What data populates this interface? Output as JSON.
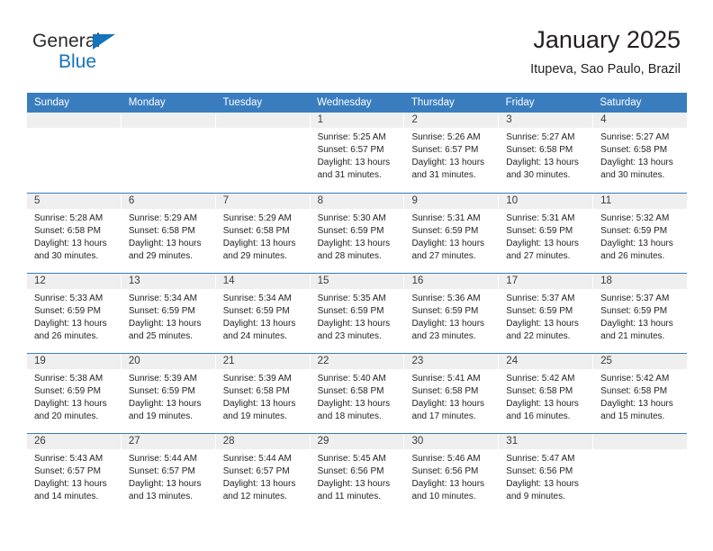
{
  "brand": {
    "name_top": "General",
    "name_bottom": "Blue",
    "triangle_color": "#1574bb"
  },
  "header": {
    "title": "January 2025",
    "subtitle": "Itupeva, Sao Paulo, Brazil"
  },
  "theme": {
    "header_blue": "#3a7dbf",
    "day_band_gray": "#efefef",
    "text_color": "#231f20"
  },
  "weekdays": [
    "Sunday",
    "Monday",
    "Tuesday",
    "Wednesday",
    "Thursday",
    "Friday",
    "Saturday"
  ],
  "weeks": [
    [
      {
        "day": "",
        "sunrise": "",
        "sunset": "",
        "daylight1": "",
        "daylight2": "",
        "empty": true
      },
      {
        "day": "",
        "sunrise": "",
        "sunset": "",
        "daylight1": "",
        "daylight2": "",
        "empty": true
      },
      {
        "day": "",
        "sunrise": "",
        "sunset": "",
        "daylight1": "",
        "daylight2": "",
        "empty": true
      },
      {
        "day": "1",
        "sunrise": "Sunrise: 5:25 AM",
        "sunset": "Sunset: 6:57 PM",
        "daylight1": "Daylight: 13 hours",
        "daylight2": "and 31 minutes."
      },
      {
        "day": "2",
        "sunrise": "Sunrise: 5:26 AM",
        "sunset": "Sunset: 6:57 PM",
        "daylight1": "Daylight: 13 hours",
        "daylight2": "and 31 minutes."
      },
      {
        "day": "3",
        "sunrise": "Sunrise: 5:27 AM",
        "sunset": "Sunset: 6:58 PM",
        "daylight1": "Daylight: 13 hours",
        "daylight2": "and 30 minutes."
      },
      {
        "day": "4",
        "sunrise": "Sunrise: 5:27 AM",
        "sunset": "Sunset: 6:58 PM",
        "daylight1": "Daylight: 13 hours",
        "daylight2": "and 30 minutes."
      }
    ],
    [
      {
        "day": "5",
        "sunrise": "Sunrise: 5:28 AM",
        "sunset": "Sunset: 6:58 PM",
        "daylight1": "Daylight: 13 hours",
        "daylight2": "and 30 minutes."
      },
      {
        "day": "6",
        "sunrise": "Sunrise: 5:29 AM",
        "sunset": "Sunset: 6:58 PM",
        "daylight1": "Daylight: 13 hours",
        "daylight2": "and 29 minutes."
      },
      {
        "day": "7",
        "sunrise": "Sunrise: 5:29 AM",
        "sunset": "Sunset: 6:58 PM",
        "daylight1": "Daylight: 13 hours",
        "daylight2": "and 29 minutes."
      },
      {
        "day": "8",
        "sunrise": "Sunrise: 5:30 AM",
        "sunset": "Sunset: 6:59 PM",
        "daylight1": "Daylight: 13 hours",
        "daylight2": "and 28 minutes."
      },
      {
        "day": "9",
        "sunrise": "Sunrise: 5:31 AM",
        "sunset": "Sunset: 6:59 PM",
        "daylight1": "Daylight: 13 hours",
        "daylight2": "and 27 minutes."
      },
      {
        "day": "10",
        "sunrise": "Sunrise: 5:31 AM",
        "sunset": "Sunset: 6:59 PM",
        "daylight1": "Daylight: 13 hours",
        "daylight2": "and 27 minutes."
      },
      {
        "day": "11",
        "sunrise": "Sunrise: 5:32 AM",
        "sunset": "Sunset: 6:59 PM",
        "daylight1": "Daylight: 13 hours",
        "daylight2": "and 26 minutes."
      }
    ],
    [
      {
        "day": "12",
        "sunrise": "Sunrise: 5:33 AM",
        "sunset": "Sunset: 6:59 PM",
        "daylight1": "Daylight: 13 hours",
        "daylight2": "and 26 minutes."
      },
      {
        "day": "13",
        "sunrise": "Sunrise: 5:34 AM",
        "sunset": "Sunset: 6:59 PM",
        "daylight1": "Daylight: 13 hours",
        "daylight2": "and 25 minutes."
      },
      {
        "day": "14",
        "sunrise": "Sunrise: 5:34 AM",
        "sunset": "Sunset: 6:59 PM",
        "daylight1": "Daylight: 13 hours",
        "daylight2": "and 24 minutes."
      },
      {
        "day": "15",
        "sunrise": "Sunrise: 5:35 AM",
        "sunset": "Sunset: 6:59 PM",
        "daylight1": "Daylight: 13 hours",
        "daylight2": "and 23 minutes."
      },
      {
        "day": "16",
        "sunrise": "Sunrise: 5:36 AM",
        "sunset": "Sunset: 6:59 PM",
        "daylight1": "Daylight: 13 hours",
        "daylight2": "and 23 minutes."
      },
      {
        "day": "17",
        "sunrise": "Sunrise: 5:37 AM",
        "sunset": "Sunset: 6:59 PM",
        "daylight1": "Daylight: 13 hours",
        "daylight2": "and 22 minutes."
      },
      {
        "day": "18",
        "sunrise": "Sunrise: 5:37 AM",
        "sunset": "Sunset: 6:59 PM",
        "daylight1": "Daylight: 13 hours",
        "daylight2": "and 21 minutes."
      }
    ],
    [
      {
        "day": "19",
        "sunrise": "Sunrise: 5:38 AM",
        "sunset": "Sunset: 6:59 PM",
        "daylight1": "Daylight: 13 hours",
        "daylight2": "and 20 minutes."
      },
      {
        "day": "20",
        "sunrise": "Sunrise: 5:39 AM",
        "sunset": "Sunset: 6:59 PM",
        "daylight1": "Daylight: 13 hours",
        "daylight2": "and 19 minutes."
      },
      {
        "day": "21",
        "sunrise": "Sunrise: 5:39 AM",
        "sunset": "Sunset: 6:58 PM",
        "daylight1": "Daylight: 13 hours",
        "daylight2": "and 19 minutes."
      },
      {
        "day": "22",
        "sunrise": "Sunrise: 5:40 AM",
        "sunset": "Sunset: 6:58 PM",
        "daylight1": "Daylight: 13 hours",
        "daylight2": "and 18 minutes."
      },
      {
        "day": "23",
        "sunrise": "Sunrise: 5:41 AM",
        "sunset": "Sunset: 6:58 PM",
        "daylight1": "Daylight: 13 hours",
        "daylight2": "and 17 minutes."
      },
      {
        "day": "24",
        "sunrise": "Sunrise: 5:42 AM",
        "sunset": "Sunset: 6:58 PM",
        "daylight1": "Daylight: 13 hours",
        "daylight2": "and 16 minutes."
      },
      {
        "day": "25",
        "sunrise": "Sunrise: 5:42 AM",
        "sunset": "Sunset: 6:58 PM",
        "daylight1": "Daylight: 13 hours",
        "daylight2": "and 15 minutes."
      }
    ],
    [
      {
        "day": "26",
        "sunrise": "Sunrise: 5:43 AM",
        "sunset": "Sunset: 6:57 PM",
        "daylight1": "Daylight: 13 hours",
        "daylight2": "and 14 minutes."
      },
      {
        "day": "27",
        "sunrise": "Sunrise: 5:44 AM",
        "sunset": "Sunset: 6:57 PM",
        "daylight1": "Daylight: 13 hours",
        "daylight2": "and 13 minutes."
      },
      {
        "day": "28",
        "sunrise": "Sunrise: 5:44 AM",
        "sunset": "Sunset: 6:57 PM",
        "daylight1": "Daylight: 13 hours",
        "daylight2": "and 12 minutes."
      },
      {
        "day": "29",
        "sunrise": "Sunrise: 5:45 AM",
        "sunset": "Sunset: 6:56 PM",
        "daylight1": "Daylight: 13 hours",
        "daylight2": "and 11 minutes."
      },
      {
        "day": "30",
        "sunrise": "Sunrise: 5:46 AM",
        "sunset": "Sunset: 6:56 PM",
        "daylight1": "Daylight: 13 hours",
        "daylight2": "and 10 minutes."
      },
      {
        "day": "31",
        "sunrise": "Sunrise: 5:47 AM",
        "sunset": "Sunset: 6:56 PM",
        "daylight1": "Daylight: 13 hours",
        "daylight2": "and 9 minutes."
      },
      {
        "day": "",
        "sunrise": "",
        "sunset": "",
        "daylight1": "",
        "daylight2": "",
        "empty": true
      }
    ]
  ]
}
